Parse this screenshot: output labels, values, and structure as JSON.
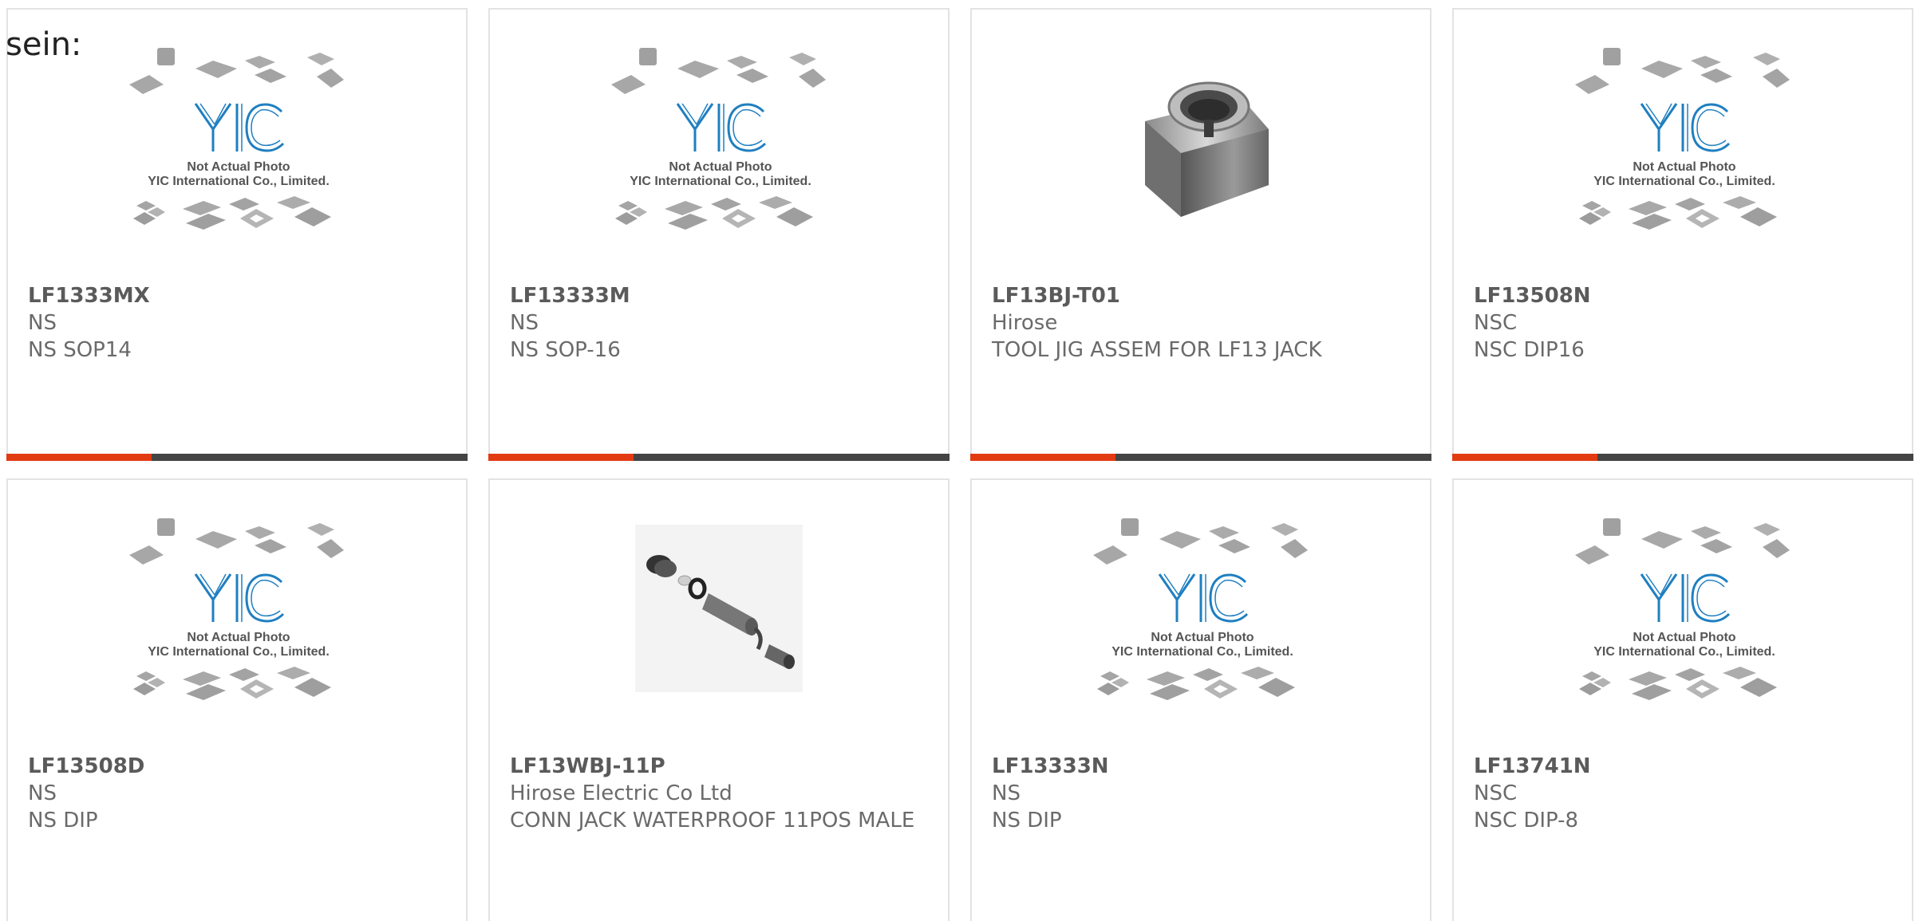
{
  "intro_text": "sein:",
  "placeholder_image": {
    "line1": "Not Actual Photo",
    "line2": "YIC International Co., Limited.",
    "logo_text": "YIC"
  },
  "products": [
    {
      "part": "LF1333MX",
      "mfr": "NS",
      "desc": "NS SOP14",
      "image": "placeholder"
    },
    {
      "part": "LF13333M",
      "mfr": "NS",
      "desc": "NS SOP-16",
      "image": "placeholder"
    },
    {
      "part": "LF13BJ-T01",
      "mfr": "Hirose",
      "desc": "TOOL JIG ASSEM FOR LF13 JACK",
      "image": "metal-jig"
    },
    {
      "part": "LF13508N",
      "mfr": "NSC",
      "desc": "NSC DIP16",
      "image": "placeholder"
    },
    {
      "part": "LF13508D",
      "mfr": "NS",
      "desc": "NS DIP",
      "image": "placeholder"
    },
    {
      "part": "LF13WBJ-11P",
      "mfr": "Hirose Electric Co Ltd",
      "desc": "CONN JACK WATERPROOF 11POS MALE",
      "image": "connector-parts"
    },
    {
      "part": "LF13333N",
      "mfr": "NS",
      "desc": "NS DIP",
      "image": "placeholder"
    },
    {
      "part": "LF13741N",
      "mfr": "NSC",
      "desc": "NSC DIP-8",
      "image": "placeholder"
    }
  ],
  "colors": {
    "accent": "#e23b12",
    "bar": "#444444",
    "border": "#e3e3e3",
    "logo_blue": "#1f7fc0"
  }
}
